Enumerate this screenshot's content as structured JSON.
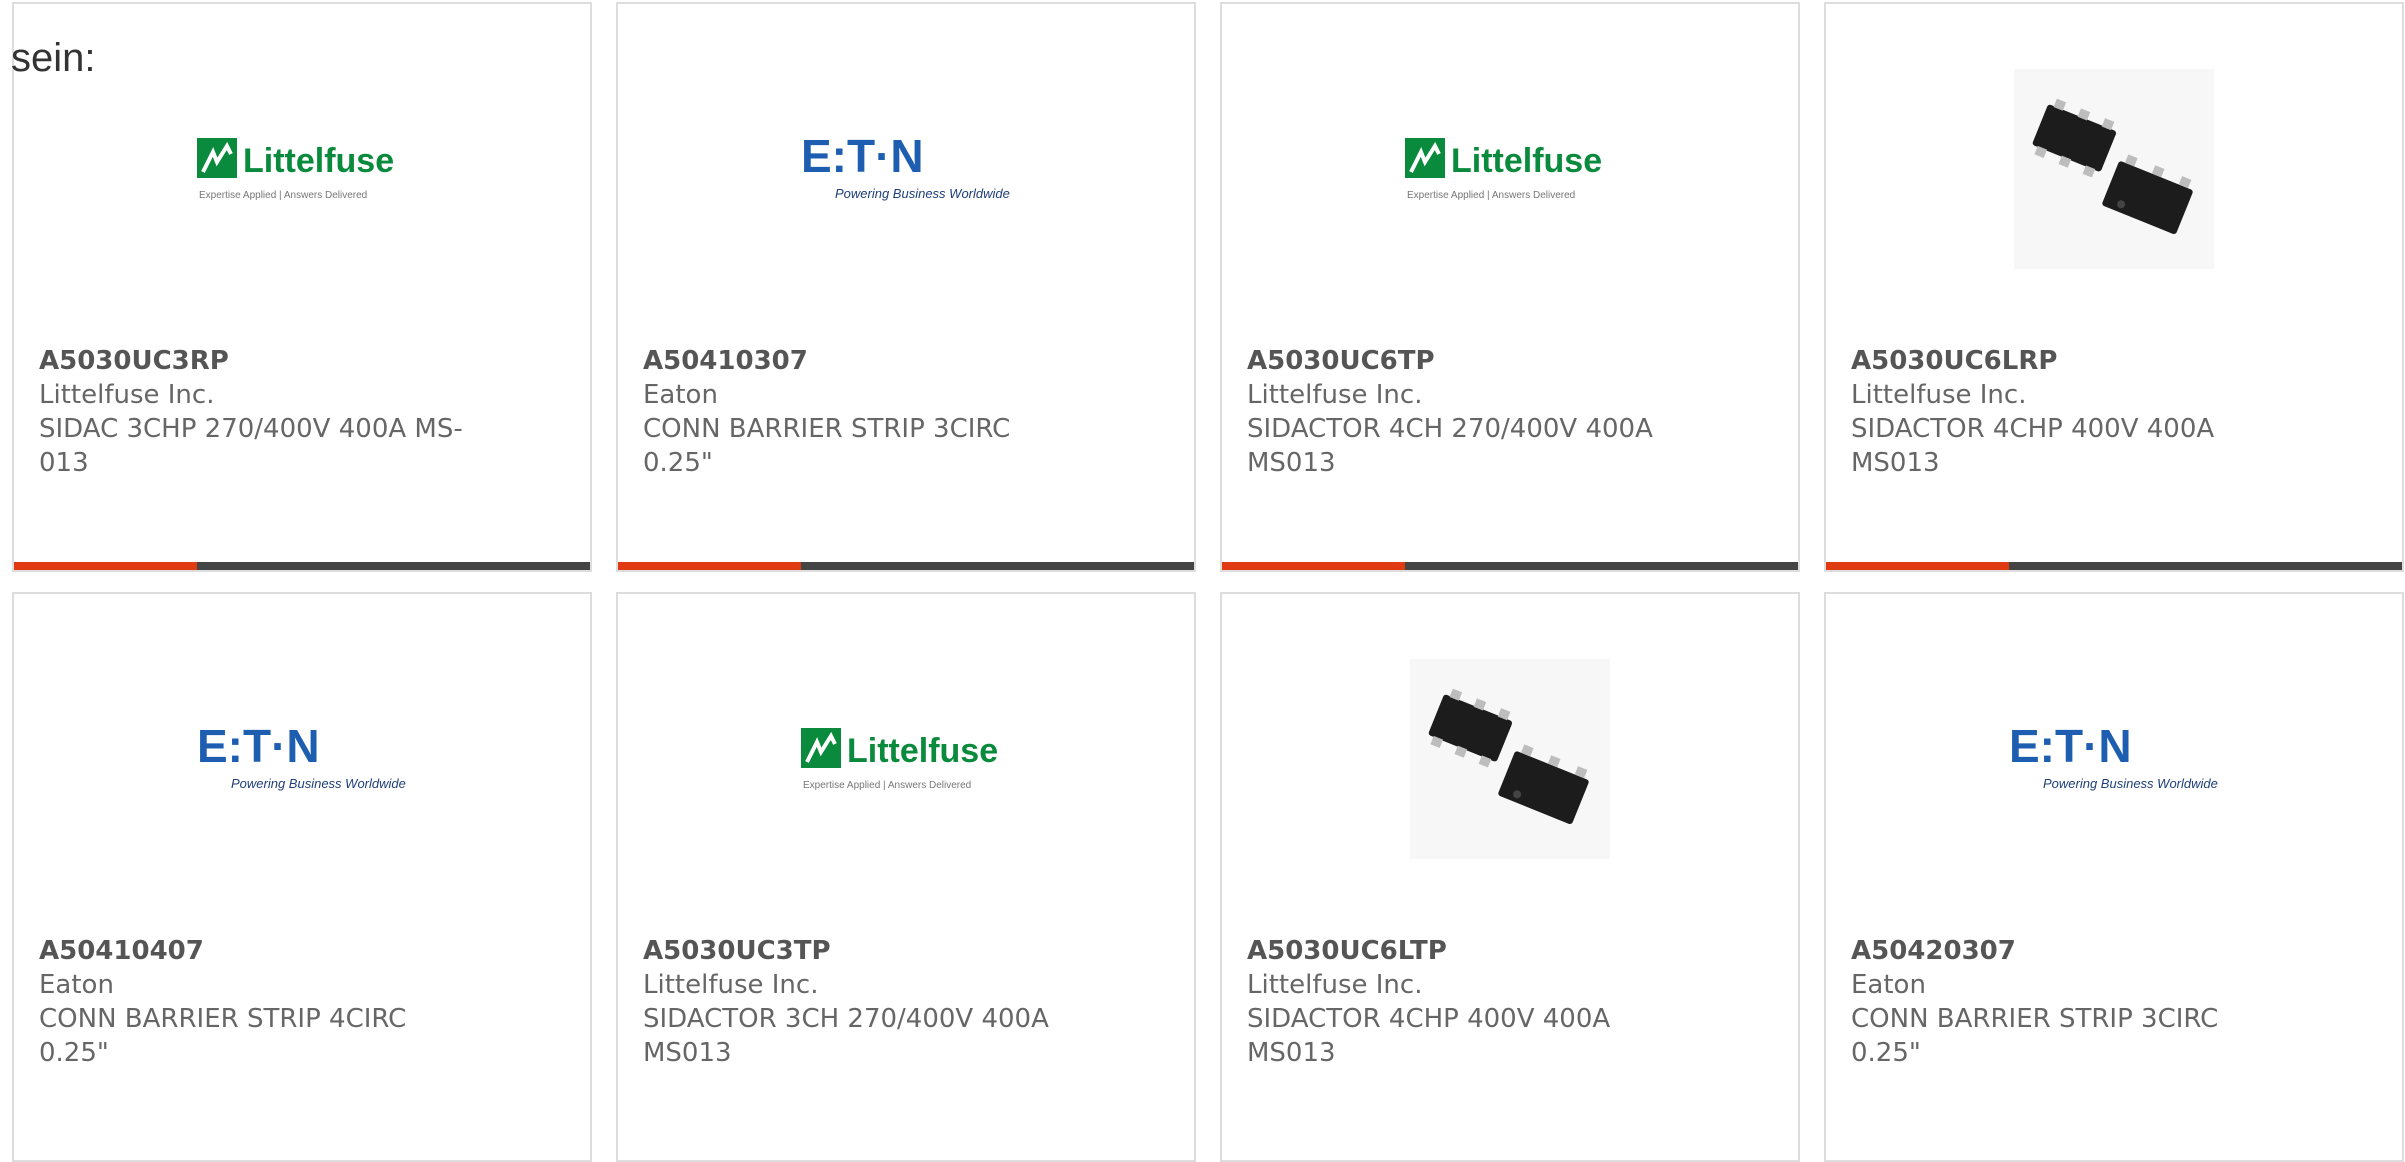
{
  "intro": "sein:",
  "colors": {
    "border": "#dddddd",
    "accent": "#e03a12",
    "bar": "#444444",
    "littelfuse_green": "#0a8a3c",
    "eaton_blue": "#1e5eb0"
  },
  "logos": {
    "littelfuse_name": "Littelfuse",
    "littelfuse_tagline": "Expertise Applied | Answers Delivered",
    "eaton_name": "E:T·N",
    "eaton_tagline": "Powering Business Worldwide"
  },
  "products": [
    {
      "pn": "A5030UC3RP",
      "mfr": "Littelfuse Inc.",
      "desc1": "SIDAC 3CHP 270/400V 400A MS-",
      "desc2": "013",
      "image": "littelfuse-logo"
    },
    {
      "pn": "A50410307",
      "mfr": "Eaton",
      "desc1": "CONN BARRIER STRIP 3CIRC",
      "desc2": "0.25\"",
      "image": "eaton-logo"
    },
    {
      "pn": "A5030UC6TP",
      "mfr": "Littelfuse Inc.",
      "desc1": "SIDACTOR 4CH 270/400V 400A",
      "desc2": "MS013",
      "image": "littelfuse-logo"
    },
    {
      "pn": "A5030UC6LRP",
      "mfr": "Littelfuse Inc.",
      "desc1": "SIDACTOR 4CHP 400V 400A",
      "desc2": "MS013",
      "image": "chip-photo"
    },
    {
      "pn": "A50410407",
      "mfr": "Eaton",
      "desc1": "CONN BARRIER STRIP 4CIRC",
      "desc2": "0.25\"",
      "image": "eaton-logo"
    },
    {
      "pn": "A5030UC3TP",
      "mfr": "Littelfuse Inc.",
      "desc1": "SIDACTOR 3CH 270/400V 400A",
      "desc2": "MS013",
      "image": "littelfuse-logo"
    },
    {
      "pn": "A5030UC6LTP",
      "mfr": "Littelfuse Inc.",
      "desc1": "SIDACTOR 4CHP 400V 400A",
      "desc2": "MS013",
      "image": "chip-photo"
    },
    {
      "pn": "A50420307",
      "mfr": "Eaton",
      "desc1": "CONN BARRIER STRIP 3CIRC",
      "desc2": "0.25\"",
      "image": "eaton-logo"
    }
  ]
}
